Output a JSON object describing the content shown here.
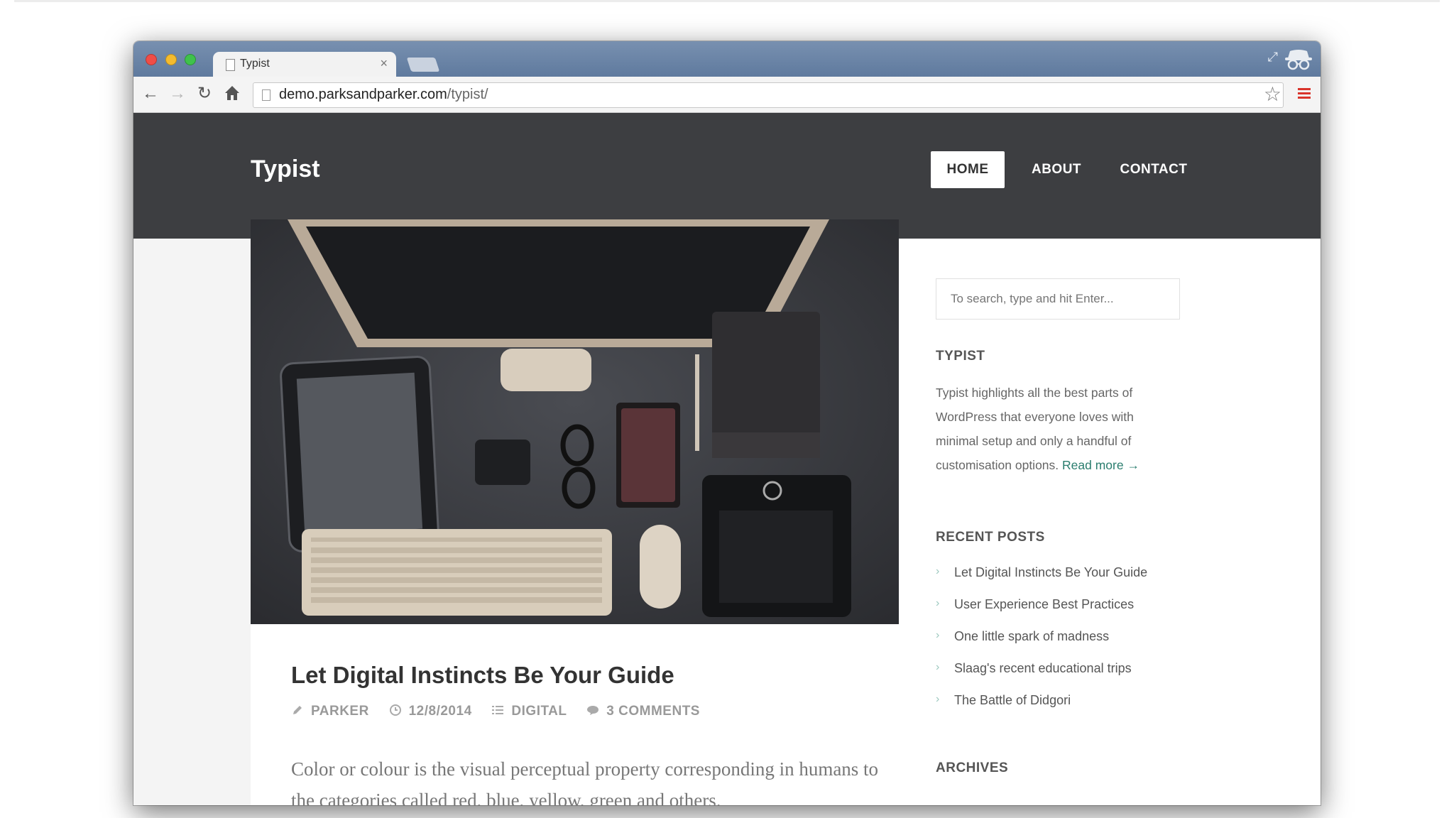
{
  "browser": {
    "tab_title": "Typist",
    "tab_close": "×",
    "url_host": "demo.parksandparker.com",
    "url_path": "/typist/"
  },
  "icons": {
    "back": "arrow-left",
    "forward": "arrow-right",
    "reload": "reload",
    "home": "home",
    "bookmark": "star",
    "menu": "hamburger",
    "fullscreen": "expand",
    "incognito": "incognito"
  },
  "site": {
    "title": "Typist",
    "nav": [
      {
        "label": "HOME",
        "active": true
      },
      {
        "label": "ABOUT"
      },
      {
        "label": "CONTACT"
      }
    ]
  },
  "post": {
    "title": "Let Digital Instincts Be Your Guide",
    "author": "PARKER",
    "date": "12/8/2014",
    "category": "DIGITAL",
    "comments": "3 COMMENTS",
    "excerpt": "Color or colour is the visual perceptual property corresponding in humans to the categories called red, blue, yellow, green and others."
  },
  "sidebar": {
    "search_placeholder": "To search, type and hit Enter...",
    "about_title": "TYPIST",
    "about_text": "Typist highlights all the best parts of WordPress that everyone loves with minimal setup and only a handful of customisation options. ",
    "read_more": "Read more →",
    "recent_title": "RECENT POSTS",
    "recent_posts": [
      "Let Digital Instincts Be Your Guide",
      "User Experience Best Practices",
      "One little spark of madness",
      "Slaag's recent educational trips",
      "The Battle of Didgori"
    ],
    "archives_title": "ARCHIVES"
  },
  "colors": {
    "header_bg": "#3d3e41",
    "accent_link": "#2a7d6e",
    "titlebar": "#6a84a8"
  }
}
